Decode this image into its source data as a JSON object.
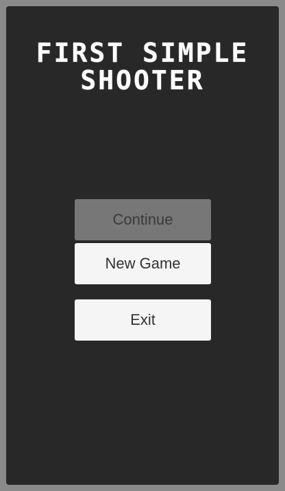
{
  "title": {
    "line1": "FIRST SIMPLE",
    "line2": "SHOOTER"
  },
  "menu": {
    "continue_label": "Continue",
    "continue_state": "disabled",
    "new_game_label": "New Game",
    "exit_label": "Exit"
  },
  "colors": {
    "background": "#282828",
    "frame": "#8a8a8a",
    "button": "#f5f5f5",
    "button_disabled": "#777777",
    "title_text": "#ffffff"
  }
}
